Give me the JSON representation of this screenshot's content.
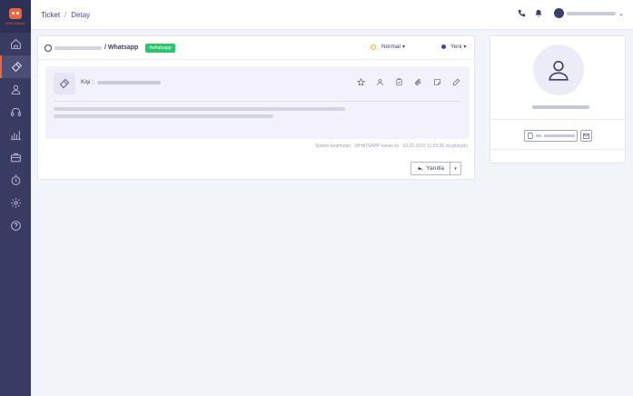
{
  "header": {
    "breadcrumb_root": "Ticket",
    "breadcrumb_separator": "/",
    "breadcrumb_current": "Detay"
  },
  "sidebar": {
    "logo_text": "ORIANNA",
    "items": [
      {
        "icon": "home-icon",
        "active": false
      },
      {
        "icon": "ticket-icon",
        "active": true
      },
      {
        "icon": "user-icon",
        "active": false
      },
      {
        "icon": "headset-icon",
        "active": false
      },
      {
        "icon": "chart-icon",
        "active": false
      },
      {
        "icon": "briefcase-icon",
        "active": false
      },
      {
        "icon": "timer-icon",
        "active": false
      },
      {
        "icon": "settings-icon",
        "active": false
      },
      {
        "icon": "help-icon",
        "active": false
      }
    ]
  },
  "ticket": {
    "channel": "/ Whatsapp",
    "tag": "#whatsapp",
    "priority": "Normal",
    "status": "Yeni",
    "contact_label": "Kişi :",
    "meta_by": "Sistem tarafından",
    "meta_channel": "WHATSAPP kanalı ile",
    "meta_time": "03.01.2022 11:03:35 oluşturuldu",
    "reply_label": "Yanıtla"
  },
  "colors": {
    "sidebar_bg": "#3a3b63",
    "accent": "#e8673c",
    "tag_green": "#30c36b",
    "priority_yellow": "#f3b41c",
    "status_blue": "#3d42a0"
  }
}
